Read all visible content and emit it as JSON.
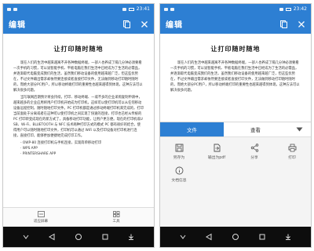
{
  "status": {
    "left_time": "23:41",
    "right_time": "23:42"
  },
  "appbar": {
    "title": "编辑"
  },
  "document": {
    "heading": "让打印随时随地",
    "paragraphs": [
      "现在人们的生活中越来越离不开各种数据终端，一部人也养成了隔几分钟必须要看一次手机的习惯，可以说智能手机、平板电脑在我们生活中已经成为了生活的必需品，并逐渐取代电脑变成我们的生活，虽然我们移动设备的使用越来越广泛，但这些优势在，不过文件输出需求却依然要连接或者直接打印文件，无法做到移动打印随时随时的，而绝大部分PC用户，所以移动终端打印的重要性也越来越得到体现，这种方法可以解决很多问题。",
      "当写联网后期预计将会持续，打印、移动终端、一或不多的企业采购复制申请中，越来越多的企业应用将用户打印机开始成为打印机，这样可以使打印机可以从任何移动设备远程控制，随时随地打印文件。PC 打印机都是通过移动终端打印机来完成的，打印当前面处于分离或者在这种可以使打印机之间实现了快速的连接，打印也已经从传统的 PC 打印转变成现在的新方式了，具备移动打印功能，让用户更方便。现在的打印机或USB、Wi-Fi、BLUETOOTH 与 NFC 技术两种打印方式的模式 PC 都有很好的结合，使得用户可以随时随地打印文件，打印机可以通过 WiFi 以及打印设备对打印机进行连接，直接打印，能够更加便捷地完成打印工作。"
    ],
    "list_items": [
      "- OWP-80 连接打印机与手机连接，实现简单移动打印",
      "· WPS APP",
      "· PRINTERSHARE APP"
    ]
  },
  "bottom_tools": [
    {
      "label": "适应屏幕",
      "icon": "fit-screen-icon"
    },
    {
      "label": "工具",
      "icon": "tools-icon"
    }
  ],
  "sheet": {
    "tabs": [
      {
        "label": "文件",
        "active": true
      },
      {
        "label": "查看",
        "active": false
      }
    ],
    "items": [
      {
        "label": "另存为",
        "icon": "save-icon"
      },
      {
        "label": "输出为pdf",
        "icon": "pdf-export-icon"
      },
      {
        "label": "分享",
        "icon": "share-icon"
      },
      {
        "label": "打印",
        "icon": "printer-icon"
      },
      {
        "label": "文档信息",
        "icon": "info-icon"
      }
    ]
  },
  "colors": {
    "accent": "#2d7fd3",
    "navbar": "#0d0d0d"
  }
}
